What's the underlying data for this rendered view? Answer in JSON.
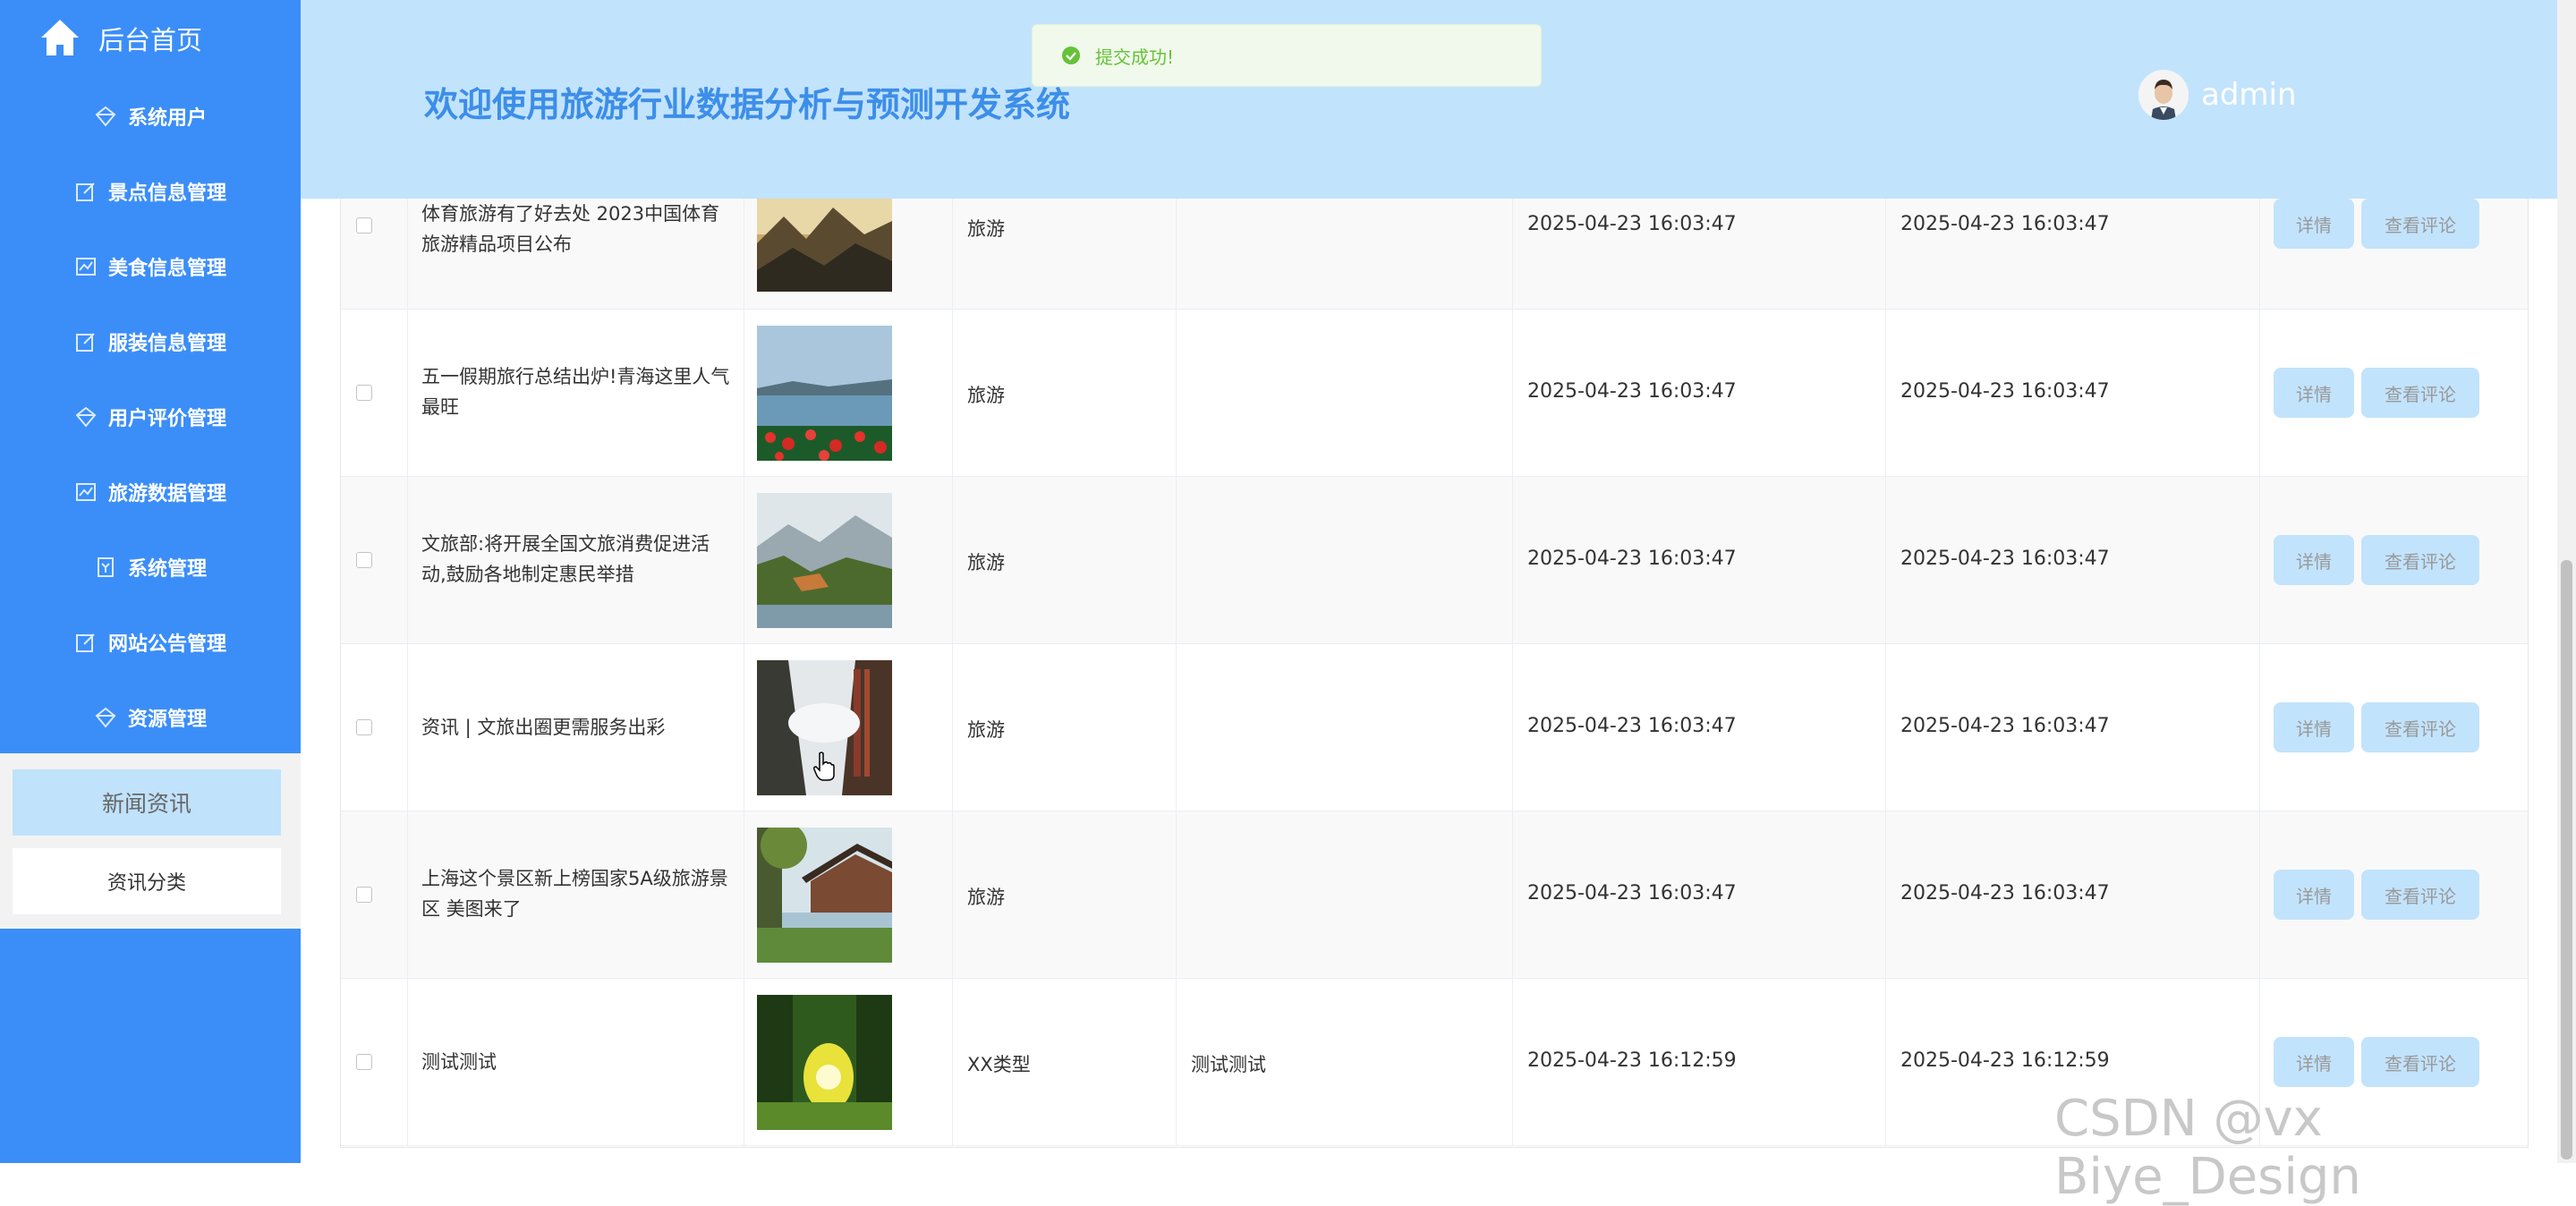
{
  "sidebar": {
    "home_label": "后台首页",
    "items": [
      {
        "label": "系统用户",
        "icon": "diamond-icon"
      },
      {
        "label": "景点信息管理",
        "icon": "edit-icon"
      },
      {
        "label": "美食信息管理",
        "icon": "chart-icon"
      },
      {
        "label": "服装信息管理",
        "icon": "edit-icon"
      },
      {
        "label": "用户评价管理",
        "icon": "diamond-icon"
      },
      {
        "label": "旅游数据管理",
        "icon": "chart-icon"
      },
      {
        "label": "系统管理",
        "icon": "badge-icon"
      },
      {
        "label": "网站公告管理",
        "icon": "edit-icon"
      },
      {
        "label": "资源管理",
        "icon": "diamond-icon"
      }
    ],
    "submenu": {
      "active_label": "新闻资讯",
      "other_label": "资讯分类"
    }
  },
  "header": {
    "title": "欢迎使用旅游行业数据分析与预测开发系统",
    "username": "admin"
  },
  "toast": {
    "text": "提交成功!"
  },
  "table": {
    "detail_label": "详情",
    "comments_label": "查看评论",
    "rows": [
      {
        "title": "体育旅游有了好去处 2023中国体育旅游精品项目公布",
        "type": "旅游",
        "content": "",
        "created": "2025-04-23 16:03:47",
        "updated": "2025-04-23 16:03:47",
        "image": "mountain-mist-image"
      },
      {
        "title": "五一假期旅行总结出炉!青海这里人气最旺",
        "type": "旅游",
        "content": "",
        "created": "2025-04-23 16:03:47",
        "updated": "2025-04-23 16:03:47",
        "image": "lake-flowers-image"
      },
      {
        "title": "文旅部:将开展全国文旅消费促进活动,鼓励各地制定惠民举措",
        "type": "旅游",
        "content": "",
        "created": "2025-04-23 16:03:47",
        "updated": "2025-04-23 16:03:47",
        "image": "mountain-lake-image"
      },
      {
        "title": "资讯 | 文旅出圈更需服务出彩",
        "type": "旅游",
        "content": "",
        "created": "2025-04-23 16:03:47",
        "updated": "2025-04-23 16:03:47",
        "image": "cliff-walkway-image"
      },
      {
        "title": "上海这个景区新上榜国家5A级旅游景区 美图来了",
        "type": "旅游",
        "content": "",
        "created": "2025-04-23 16:03:47",
        "updated": "2025-04-23 16:03:47",
        "image": "lakeside-house-image"
      },
      {
        "title": "测试测试",
        "type": "XX类型",
        "content": "测试测试",
        "created": "2025-04-23 16:12:59",
        "updated": "2025-04-23 16:12:59",
        "image": "forest-sunlight-image"
      }
    ]
  },
  "watermark": "CSDN @vx Biye_Design",
  "colors": {
    "sidebar": "#3b8ef8",
    "header": "#c2e3fc",
    "title": "#3c8ee9",
    "button": "#c2e3fc",
    "success": "#67c23a"
  }
}
